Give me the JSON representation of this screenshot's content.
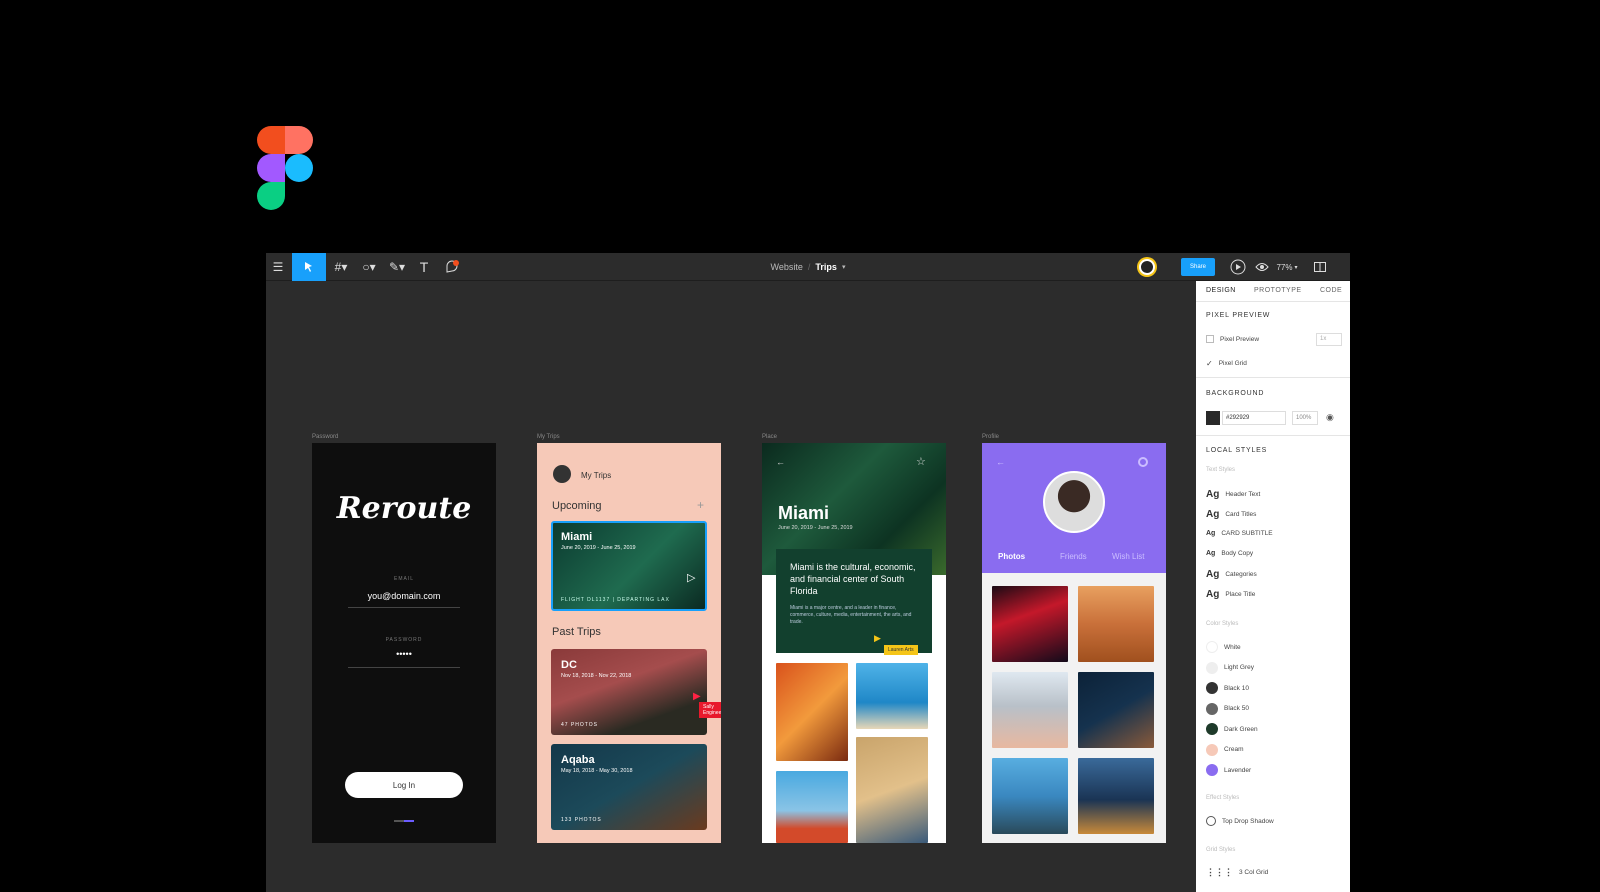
{
  "toolbar": {
    "menu_icon": "hamburger-icon",
    "tools": [
      "move-icon",
      "frame-icon",
      "shape-icon",
      "pen-icon",
      "text-icon",
      "comment-icon"
    ],
    "breadcrumb_project": "Website",
    "breadcrumb_sep": "/",
    "breadcrumb_page": "Trips",
    "breadcrumb_caret": "▾",
    "share_label": "Share",
    "zoom": "77%",
    "zoom_caret": "▾"
  },
  "frames": {
    "password": {
      "label": "Password",
      "logo_text": "Reroute",
      "email_label": "EMAIL",
      "email_value": "you@domain.com",
      "password_label": "PASSWORD",
      "password_value": "•••••",
      "button": "Log In"
    },
    "trips": {
      "label": "My Trips",
      "header": "My Trips",
      "upcoming": "Upcoming",
      "plus": "+",
      "card1_title": "Miami",
      "card1_dates": "June 20, 2019 - June 25, 2019",
      "card1_footer": "FLIGHT DL1137 | DEPARTING LAX",
      "past": "Past Trips",
      "card2_title": "DC",
      "card2_dates": "Nov 18, 2018 - Nov 22, 2018",
      "card2_footer": "47 PHOTOS",
      "cursor_label": "Sally Engineer",
      "card3_title": "Aqaba",
      "card3_dates": "May 18, 2018 - May 30, 2018",
      "card3_footer": "133 PHOTOS"
    },
    "place": {
      "label": "Place",
      "title": "Miami",
      "dates": "June 20, 2019 - June 25, 2019",
      "desc": "Miami is the cultural, economic, and financial center of South Florida",
      "body": "Miami is a major centre, and a leader in finance, commerce, culture, media, entertainment, the arts, and trade.",
      "cursor_label": "Lauren Arts"
    },
    "profile": {
      "label": "Profile",
      "tabs": [
        "Photos",
        "Friends",
        "Wish List"
      ]
    }
  },
  "panel": {
    "tabs": [
      "DESIGN",
      "PROTOTYPE",
      "CODE"
    ],
    "pixel_preview_title": "PIXEL PREVIEW",
    "pixel_preview": "Pixel Preview",
    "pixel_preview_value": "1x",
    "pixel_grid": "Pixel Grid",
    "background_title": "BACKGROUND",
    "bg_hex": "#292929",
    "bg_opacity": "100%",
    "local_styles_title": "LOCAL STYLES",
    "text_styles_title": "Text Styles",
    "text_styles": [
      "Header Text",
      "Card Titles",
      "CARD SUBTITLE",
      "Body Copy",
      "Categories",
      "Place Title"
    ],
    "color_styles_title": "Color Styles",
    "colors": [
      {
        "name": "White",
        "hex": "#ffffff"
      },
      {
        "name": "Light Grey",
        "hex": "#eeeeee"
      },
      {
        "name": "Black 10",
        "hex": "#333333"
      },
      {
        "name": "Black 50",
        "hex": "#666666"
      },
      {
        "name": "Dark Green",
        "hex": "#1e3a2a"
      },
      {
        "name": "Cream",
        "hex": "#f6c9b8"
      },
      {
        "name": "Lavender",
        "hex": "#8a6cf0"
      }
    ],
    "effect_styles_title": "Effect Styles",
    "effect": "Top Drop Shadow",
    "grid_styles_title": "Grid Styles",
    "grid": "3 Col Grid"
  },
  "colors": {
    "accent": "#18a0fb",
    "canvas": "#2c2c2c",
    "cream": "#f6c9b8",
    "lavender": "#8a6cf0"
  }
}
